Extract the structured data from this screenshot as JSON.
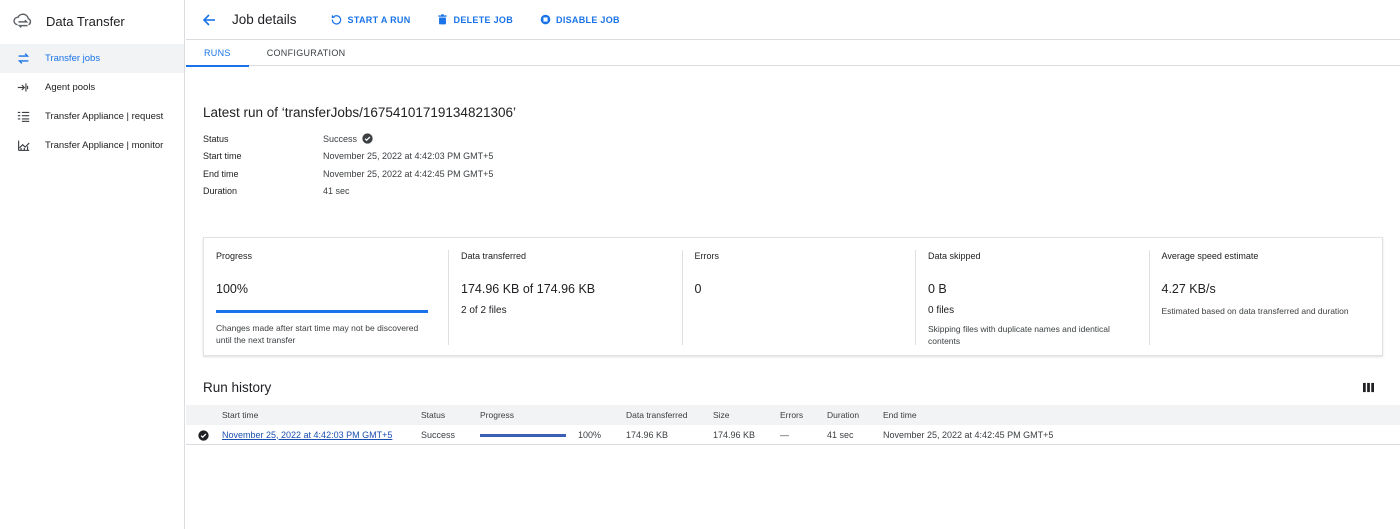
{
  "sidebar": {
    "title": "Data Transfer",
    "items": [
      {
        "label": "Transfer jobs",
        "icon": "swap-arrows-icon",
        "active": true
      },
      {
        "label": "Agent pools",
        "icon": "agent-pool-icon",
        "active": false
      },
      {
        "label": "Transfer Appliance | request",
        "icon": "list-request-icon",
        "active": false
      },
      {
        "label": "Transfer Appliance | monitor",
        "icon": "monitor-chart-icon",
        "active": false
      }
    ]
  },
  "toolbar": {
    "title": "Job details",
    "actions": [
      {
        "label": "START A RUN",
        "icon": "refresh-icon"
      },
      {
        "label": "DELETE JOB",
        "icon": "trash-icon"
      },
      {
        "label": "DISABLE JOB",
        "icon": "stop-circle-icon"
      }
    ]
  },
  "tabs": [
    {
      "label": "RUNS",
      "active": true
    },
    {
      "label": "CONFIGURATION",
      "active": false
    }
  ],
  "latest_run": {
    "heading": "Latest run of ‘transferJobs/16754101719134821306’",
    "fields": [
      {
        "key": "Status",
        "value": "Success"
      },
      {
        "key": "Start time",
        "value": "November 25, 2022 at 4:42:03 PM GMT+5"
      },
      {
        "key": "End time",
        "value": "November 25, 2022 at 4:42:45 PM GMT+5"
      },
      {
        "key": "Duration",
        "value": "41 sec"
      }
    ]
  },
  "stats": {
    "progress": {
      "title": "Progress",
      "value": "100%",
      "fraction": 1.0,
      "note": "Changes made after start time may not be discovered until the next transfer"
    },
    "data_transferred": {
      "title": "Data transferred",
      "value": "174.96 KB of 174.96 KB",
      "sub": "2 of 2 files"
    },
    "errors": {
      "title": "Errors",
      "value": "0"
    },
    "data_skipped": {
      "title": "Data skipped",
      "value": "0 B",
      "sub": "0 files",
      "note": "Skipping files with duplicate names and identical contents"
    },
    "avg_speed": {
      "title": "Average speed estimate",
      "value": "4.27 KB/s",
      "note": "Estimated based on data transferred and duration"
    }
  },
  "run_history": {
    "title": "Run history",
    "columns": [
      "Start time",
      "Status",
      "Progress",
      "Data transferred",
      "Size",
      "Errors",
      "Duration",
      "End time"
    ],
    "rows": [
      {
        "start_time": "November 25, 2022 at 4:42:03 PM GMT+5",
        "status": "Success",
        "progress": "100%",
        "progress_fraction": 1.0,
        "data_transferred": "174.96 KB",
        "size": "174.96 KB",
        "errors": "—",
        "duration": "41 sec",
        "end_time": "November 25, 2022 at 4:42:45 PM GMT+5"
      }
    ]
  },
  "colors": {
    "accent": "#1a73e8",
    "text": "#202124",
    "border": "#dadce0",
    "header_bg": "#f1f3f4"
  }
}
